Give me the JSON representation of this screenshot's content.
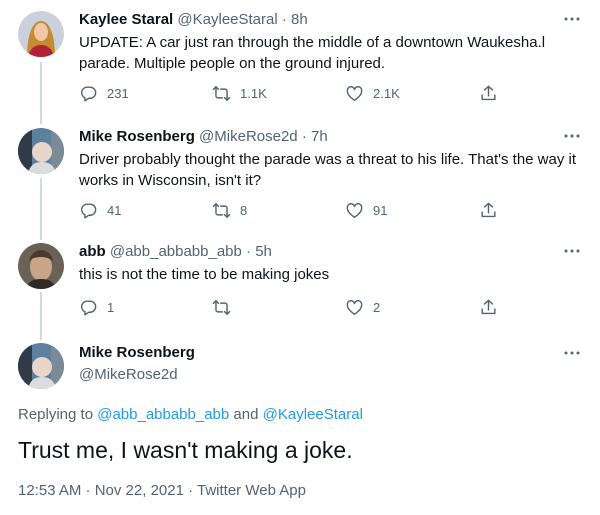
{
  "tweets": [
    {
      "name": "Kaylee Staral",
      "handle": "@KayleeStaral",
      "time": "8h",
      "text": "UPDATE: A car just ran through the middle of a downtown Waukesha.l parade. Multiple people on the ground injured.",
      "replies": "231",
      "retweets": "1.1K",
      "likes": "2.1K"
    },
    {
      "name": "Mike Rosenberg",
      "handle": "@MikeRose2d",
      "time": "7h",
      "text": "Driver probably thought the parade was a threat to his life.  That's the way it works in Wisconsin, isn't it?",
      "replies": "41",
      "retweets": "8",
      "likes": "91"
    },
    {
      "name": "abb",
      "handle": "@abb_abbabb_abb",
      "time": "5h",
      "text": "this is not the time to be making jokes",
      "replies": "1",
      "retweets": "",
      "likes": "2"
    }
  ],
  "focus": {
    "name": "Mike Rosenberg",
    "handle": "@MikeRose2d",
    "replying_prefix": "Replying to ",
    "replying_user1": "@abb_abbabb_abb",
    "replying_and": " and ",
    "replying_user2": "@KayleeStaral",
    "text": "Trust me, I wasn't making a joke.",
    "timestamp": "12:53 AM · Nov 22, 2021 · Twitter Web App"
  },
  "sep": " · ",
  "colors": {
    "accent": "#1d9bf0",
    "muted": "#536471",
    "text": "#0f1419",
    "line": "#cfd9de"
  },
  "icons": [
    "reply-icon",
    "retweet-icon",
    "like-icon",
    "share-icon",
    "more-options-icon"
  ]
}
